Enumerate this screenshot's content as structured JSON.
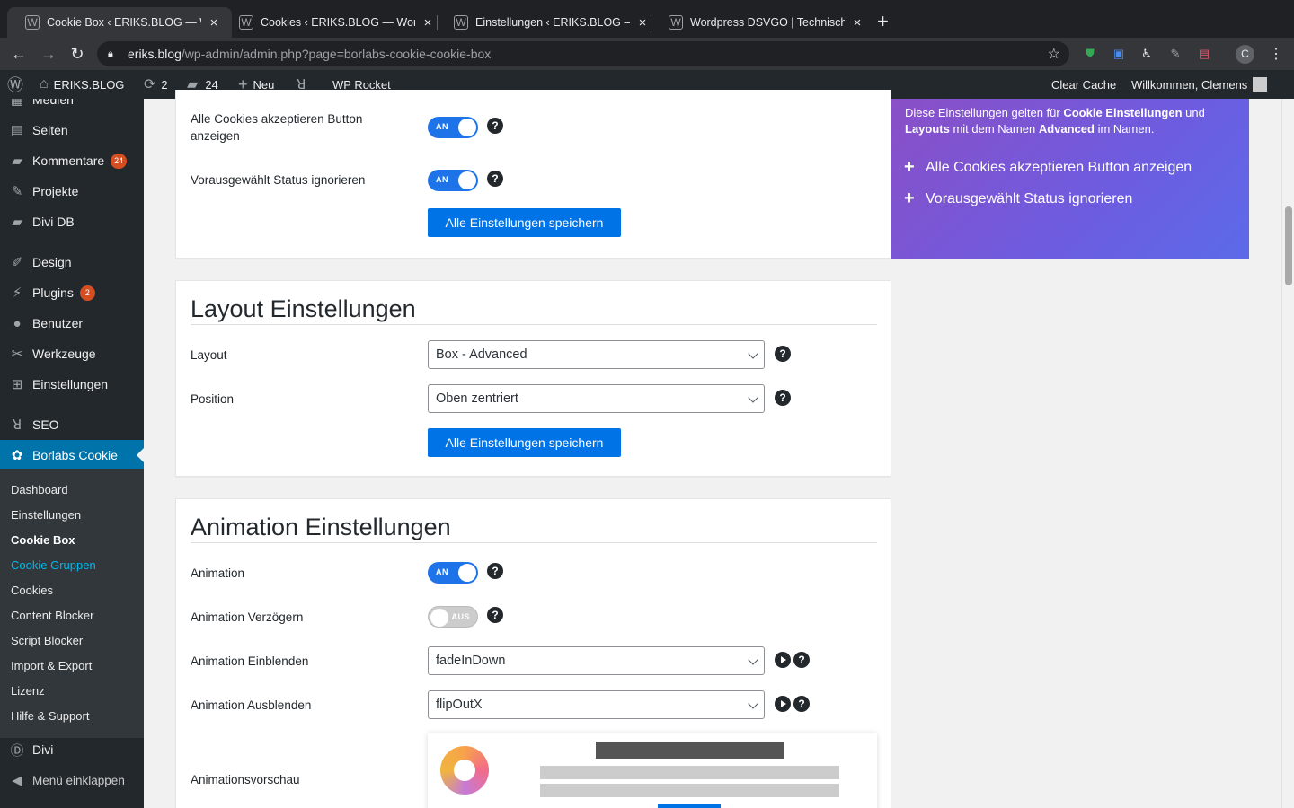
{
  "browser": {
    "tabs": [
      {
        "title": "Cookie Box ‹ ERIKS.BLOG — W",
        "active": true
      },
      {
        "title": "Cookies ‹ ERIKS.BLOG — Word",
        "active": false
      },
      {
        "title": "Einstellungen ‹ ERIKS.BLOG —",
        "active": false
      },
      {
        "title": "Wordpress DSVGO | Technisch",
        "active": false
      }
    ],
    "new_tab": "+",
    "url_host": "eriks.blog",
    "url_path": "/wp-admin/admin.php?page=borlabs-cookie-cookie-box",
    "profile_initial": "C"
  },
  "adminbar": {
    "site_name": "ERIKS.BLOG",
    "updates_count": "2",
    "comments_count": "24",
    "new_label": "Neu",
    "wp_rocket": "WP Rocket",
    "clear_cache": "Clear Cache",
    "welcome": "Willkommen, Clemens"
  },
  "sidebar": {
    "items": [
      {
        "label": "Medien",
        "icon": "media-icon"
      },
      {
        "label": "Seiten",
        "icon": "pages-icon"
      },
      {
        "label": "Kommentare",
        "icon": "comments-icon",
        "count": "24"
      },
      {
        "label": "Projekte",
        "icon": "pin-icon"
      },
      {
        "label": "Divi DB",
        "icon": "comment-bubble-icon"
      },
      {
        "label": "Design",
        "icon": "brush-icon"
      },
      {
        "label": "Plugins",
        "icon": "plugin-icon",
        "count": "2"
      },
      {
        "label": "Benutzer",
        "icon": "user-icon"
      },
      {
        "label": "Werkzeuge",
        "icon": "wrench-icon"
      },
      {
        "label": "Einstellungen",
        "icon": "settings-icon"
      },
      {
        "label": "SEO",
        "icon": "yoast-icon"
      },
      {
        "label": "Borlabs Cookie",
        "icon": "borlabs-icon"
      },
      {
        "label": "Divi",
        "icon": "divi-icon"
      },
      {
        "label": "Menü einklappen",
        "icon": "collapse-icon"
      }
    ],
    "submenu": [
      "Dashboard",
      "Einstellungen",
      "Cookie Box",
      "Cookie Gruppen",
      "Cookies",
      "Content Blocker",
      "Script Blocker",
      "Import & Export",
      "Lizenz",
      "Hilfe & Support"
    ]
  },
  "top_panel": {
    "row1_label": "Alle Cookies akzeptieren Button anzeigen",
    "row1_toggle": "AN",
    "row2_label": "Vorausgewählt Status ignorieren",
    "row2_toggle": "AN",
    "save_label": "Alle Einstellungen speichern"
  },
  "info_box": {
    "text_part1": "Diese Einstellungen gelten für ",
    "text_bold1": "Cookie Einstellungen",
    "text_part2": " und ",
    "text_bold2": "Layouts",
    "text_part3": " mit dem Namen ",
    "text_bold3": "Advanced",
    "text_part4": " im Namen.",
    "item1": "Alle Cookies akzeptieren Button anzeigen",
    "item2": "Vorausgewählt Status ignorieren"
  },
  "layout_panel": {
    "title": "Layout Einstellungen",
    "layout_label": "Layout",
    "layout_value": "Box - Advanced",
    "position_label": "Position",
    "position_value": "Oben zentriert",
    "save_label": "Alle Einstellungen speichern"
  },
  "animation_panel": {
    "title": "Animation Einstellungen",
    "animation_label": "Animation",
    "animation_toggle": "AN",
    "delay_label": "Animation Verzögern",
    "delay_toggle": "AUS",
    "in_label": "Animation Einblenden",
    "in_value": "fadeInDown",
    "out_label": "Animation Ausblenden",
    "out_value": "flipOutX",
    "preview_label": "Animationsvorschau"
  },
  "help_glyph": "?",
  "colors": {
    "wp_blue": "#0073aa",
    "toggle_on": "#1e73e8",
    "button": "#0073e6",
    "badge": "#d54e21"
  }
}
